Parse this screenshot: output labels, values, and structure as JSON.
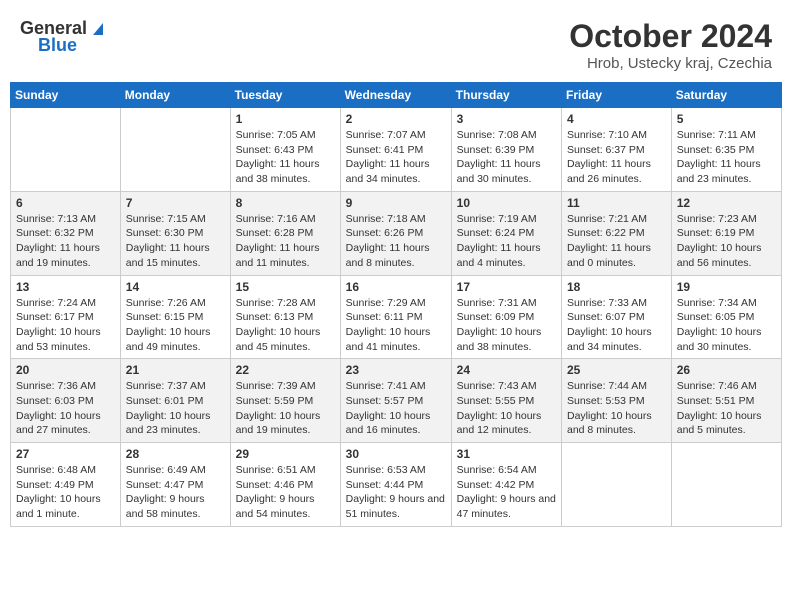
{
  "header": {
    "logo_general": "General",
    "logo_blue": "Blue",
    "title": "October 2024",
    "location": "Hrob, Ustecky kraj, Czechia"
  },
  "weekdays": [
    "Sunday",
    "Monday",
    "Tuesday",
    "Wednesday",
    "Thursday",
    "Friday",
    "Saturday"
  ],
  "weeks": [
    [
      {
        "day": "",
        "sunrise": "",
        "sunset": "",
        "daylight": ""
      },
      {
        "day": "",
        "sunrise": "",
        "sunset": "",
        "daylight": ""
      },
      {
        "day": "1",
        "sunrise": "Sunrise: 7:05 AM",
        "sunset": "Sunset: 6:43 PM",
        "daylight": "Daylight: 11 hours and 38 minutes."
      },
      {
        "day": "2",
        "sunrise": "Sunrise: 7:07 AM",
        "sunset": "Sunset: 6:41 PM",
        "daylight": "Daylight: 11 hours and 34 minutes."
      },
      {
        "day": "3",
        "sunrise": "Sunrise: 7:08 AM",
        "sunset": "Sunset: 6:39 PM",
        "daylight": "Daylight: 11 hours and 30 minutes."
      },
      {
        "day": "4",
        "sunrise": "Sunrise: 7:10 AM",
        "sunset": "Sunset: 6:37 PM",
        "daylight": "Daylight: 11 hours and 26 minutes."
      },
      {
        "day": "5",
        "sunrise": "Sunrise: 7:11 AM",
        "sunset": "Sunset: 6:35 PM",
        "daylight": "Daylight: 11 hours and 23 minutes."
      }
    ],
    [
      {
        "day": "6",
        "sunrise": "Sunrise: 7:13 AM",
        "sunset": "Sunset: 6:32 PM",
        "daylight": "Daylight: 11 hours and 19 minutes."
      },
      {
        "day": "7",
        "sunrise": "Sunrise: 7:15 AM",
        "sunset": "Sunset: 6:30 PM",
        "daylight": "Daylight: 11 hours and 15 minutes."
      },
      {
        "day": "8",
        "sunrise": "Sunrise: 7:16 AM",
        "sunset": "Sunset: 6:28 PM",
        "daylight": "Daylight: 11 hours and 11 minutes."
      },
      {
        "day": "9",
        "sunrise": "Sunrise: 7:18 AM",
        "sunset": "Sunset: 6:26 PM",
        "daylight": "Daylight: 11 hours and 8 minutes."
      },
      {
        "day": "10",
        "sunrise": "Sunrise: 7:19 AM",
        "sunset": "Sunset: 6:24 PM",
        "daylight": "Daylight: 11 hours and 4 minutes."
      },
      {
        "day": "11",
        "sunrise": "Sunrise: 7:21 AM",
        "sunset": "Sunset: 6:22 PM",
        "daylight": "Daylight: 11 hours and 0 minutes."
      },
      {
        "day": "12",
        "sunrise": "Sunrise: 7:23 AM",
        "sunset": "Sunset: 6:19 PM",
        "daylight": "Daylight: 10 hours and 56 minutes."
      }
    ],
    [
      {
        "day": "13",
        "sunrise": "Sunrise: 7:24 AM",
        "sunset": "Sunset: 6:17 PM",
        "daylight": "Daylight: 10 hours and 53 minutes."
      },
      {
        "day": "14",
        "sunrise": "Sunrise: 7:26 AM",
        "sunset": "Sunset: 6:15 PM",
        "daylight": "Daylight: 10 hours and 49 minutes."
      },
      {
        "day": "15",
        "sunrise": "Sunrise: 7:28 AM",
        "sunset": "Sunset: 6:13 PM",
        "daylight": "Daylight: 10 hours and 45 minutes."
      },
      {
        "day": "16",
        "sunrise": "Sunrise: 7:29 AM",
        "sunset": "Sunset: 6:11 PM",
        "daylight": "Daylight: 10 hours and 41 minutes."
      },
      {
        "day": "17",
        "sunrise": "Sunrise: 7:31 AM",
        "sunset": "Sunset: 6:09 PM",
        "daylight": "Daylight: 10 hours and 38 minutes."
      },
      {
        "day": "18",
        "sunrise": "Sunrise: 7:33 AM",
        "sunset": "Sunset: 6:07 PM",
        "daylight": "Daylight: 10 hours and 34 minutes."
      },
      {
        "day": "19",
        "sunrise": "Sunrise: 7:34 AM",
        "sunset": "Sunset: 6:05 PM",
        "daylight": "Daylight: 10 hours and 30 minutes."
      }
    ],
    [
      {
        "day": "20",
        "sunrise": "Sunrise: 7:36 AM",
        "sunset": "Sunset: 6:03 PM",
        "daylight": "Daylight: 10 hours and 27 minutes."
      },
      {
        "day": "21",
        "sunrise": "Sunrise: 7:37 AM",
        "sunset": "Sunset: 6:01 PM",
        "daylight": "Daylight: 10 hours and 23 minutes."
      },
      {
        "day": "22",
        "sunrise": "Sunrise: 7:39 AM",
        "sunset": "Sunset: 5:59 PM",
        "daylight": "Daylight: 10 hours and 19 minutes."
      },
      {
        "day": "23",
        "sunrise": "Sunrise: 7:41 AM",
        "sunset": "Sunset: 5:57 PM",
        "daylight": "Daylight: 10 hours and 16 minutes."
      },
      {
        "day": "24",
        "sunrise": "Sunrise: 7:43 AM",
        "sunset": "Sunset: 5:55 PM",
        "daylight": "Daylight: 10 hours and 12 minutes."
      },
      {
        "day": "25",
        "sunrise": "Sunrise: 7:44 AM",
        "sunset": "Sunset: 5:53 PM",
        "daylight": "Daylight: 10 hours and 8 minutes."
      },
      {
        "day": "26",
        "sunrise": "Sunrise: 7:46 AM",
        "sunset": "Sunset: 5:51 PM",
        "daylight": "Daylight: 10 hours and 5 minutes."
      }
    ],
    [
      {
        "day": "27",
        "sunrise": "Sunrise: 6:48 AM",
        "sunset": "Sunset: 4:49 PM",
        "daylight": "Daylight: 10 hours and 1 minute."
      },
      {
        "day": "28",
        "sunrise": "Sunrise: 6:49 AM",
        "sunset": "Sunset: 4:47 PM",
        "daylight": "Daylight: 9 hours and 58 minutes."
      },
      {
        "day": "29",
        "sunrise": "Sunrise: 6:51 AM",
        "sunset": "Sunset: 4:46 PM",
        "daylight": "Daylight: 9 hours and 54 minutes."
      },
      {
        "day": "30",
        "sunrise": "Sunrise: 6:53 AM",
        "sunset": "Sunset: 4:44 PM",
        "daylight": "Daylight: 9 hours and 51 minutes."
      },
      {
        "day": "31",
        "sunrise": "Sunrise: 6:54 AM",
        "sunset": "Sunset: 4:42 PM",
        "daylight": "Daylight: 9 hours and 47 minutes."
      },
      {
        "day": "",
        "sunrise": "",
        "sunset": "",
        "daylight": ""
      },
      {
        "day": "",
        "sunrise": "",
        "sunset": "",
        "daylight": ""
      }
    ]
  ]
}
